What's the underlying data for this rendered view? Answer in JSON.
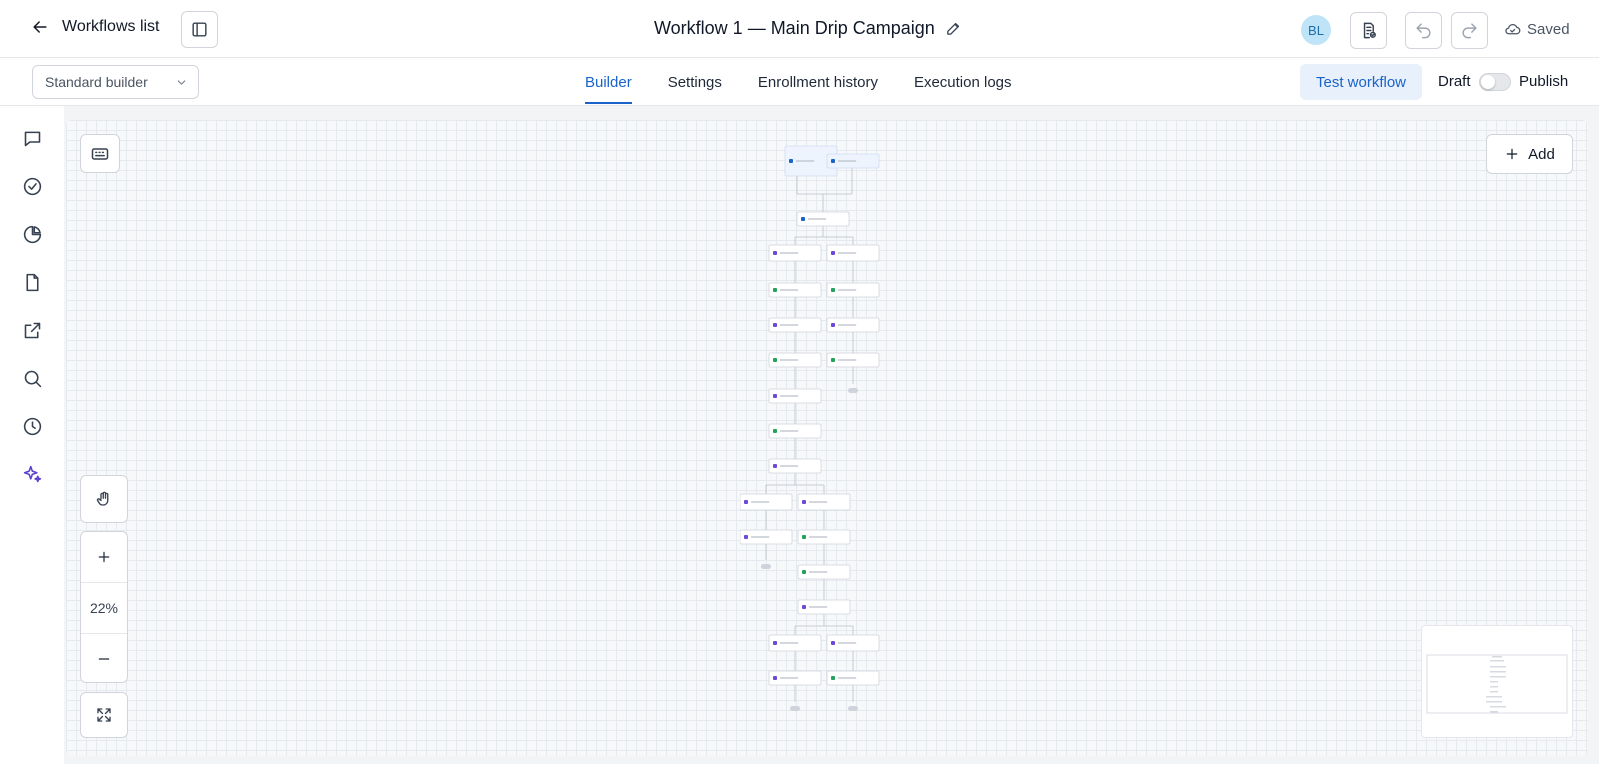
{
  "topbar": {
    "back_label": "Workflows list",
    "workflow_title": "Workflow 1 — Main Drip Campaign",
    "avatar_initials": "BL",
    "status": "Saved"
  },
  "subbar": {
    "builder_mode": "Standard builder",
    "tabs": [
      {
        "label": "Builder",
        "active": true
      },
      {
        "label": "Settings",
        "active": false
      },
      {
        "label": "Enrollment history",
        "active": false
      },
      {
        "label": "Execution logs",
        "active": false
      }
    ],
    "test_label": "Test workflow",
    "draft_label": "Draft",
    "publish_label": "Publish",
    "published": false
  },
  "rail": [
    {
      "icon": "chat-icon"
    },
    {
      "icon": "check-circle-icon"
    },
    {
      "icon": "pie-chart-icon"
    },
    {
      "icon": "file-icon"
    },
    {
      "icon": "external-link-icon"
    },
    {
      "icon": "search-icon"
    },
    {
      "icon": "history-icon"
    },
    {
      "icon": "sparkles-icon"
    }
  ],
  "canvas": {
    "zoom": "22%",
    "add_label": "Add"
  },
  "colors": {
    "accent": "#1a63c9",
    "accent_bg": "#e8f0fb",
    "ai_purple": "#5b3fd1",
    "node_green": "#22a35a",
    "node_purple": "#6d4ad6"
  }
}
